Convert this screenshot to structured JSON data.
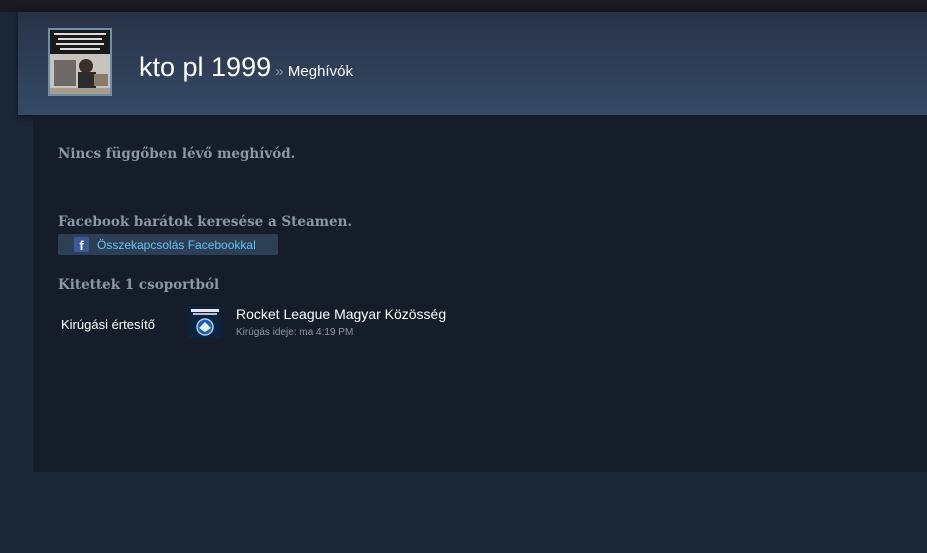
{
  "header": {
    "persona_name": "kto pl 1999",
    "separator": "»",
    "breadcrumb": "Meghívók"
  },
  "sections": {
    "no_pending": "Nincs függőben lévő meghívód.",
    "facebook_heading": "Facebook barátok keresése a Steamen.",
    "facebook_button": "Összekapcsolás Facebookkal",
    "kicked_heading": "Kitettek 1 csoportból"
  },
  "kicked": {
    "label": "Kirúgási értesítő",
    "group_name": "Rocket League Magyar Közösség",
    "kick_date": "Kirúgás ideje: ma 4:19 PM"
  },
  "icons": {
    "facebook": "facebook-icon",
    "group_avatar": "rocket-league-logo"
  },
  "colors": {
    "page_bg": "#1b2838",
    "content_bg": "#141d29",
    "link": "#67c1f5",
    "facebook_blue": "#3b5998"
  }
}
